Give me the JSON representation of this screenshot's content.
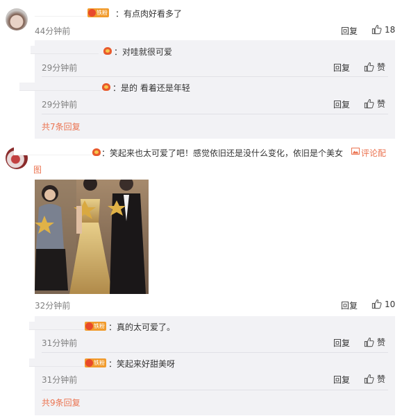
{
  "colors": {
    "link": "#eb7350",
    "muted": "#808080",
    "subbox": "#f2f2f5",
    "badge": "#f19b2c"
  },
  "comment1": {
    "badge": "铁粉",
    "text": "：有点肉好看多了",
    "time": "44分钟前",
    "reply": "回复",
    "likes": "18",
    "replies": [
      {
        "text": "：对哇就很可爱",
        "time": "29分钟前",
        "reply": "回复",
        "like": "赞"
      },
      {
        "text": "：是的 看着还是年轻",
        "time": "29分钟前",
        "reply": "回复",
        "like": "赞"
      }
    ],
    "more": "共7条回复"
  },
  "comment2": {
    "text": "：笑起来也太可爱了吧！感觉依旧还是没什么变化，依旧是个美女",
    "pic_link": "评论配图",
    "time": "32分钟前",
    "reply": "回复",
    "likes": "10",
    "replies": [
      {
        "badge": "铁粉",
        "text": "：真的太可爱了。",
        "time": "31分钟前",
        "reply": "回复",
        "like": "赞"
      },
      {
        "badge": "铁粉",
        "text": "：笑起来好甜美呀",
        "time": "31分钟前",
        "reply": "回复",
        "like": "赞"
      }
    ],
    "more": "共9条回复"
  }
}
